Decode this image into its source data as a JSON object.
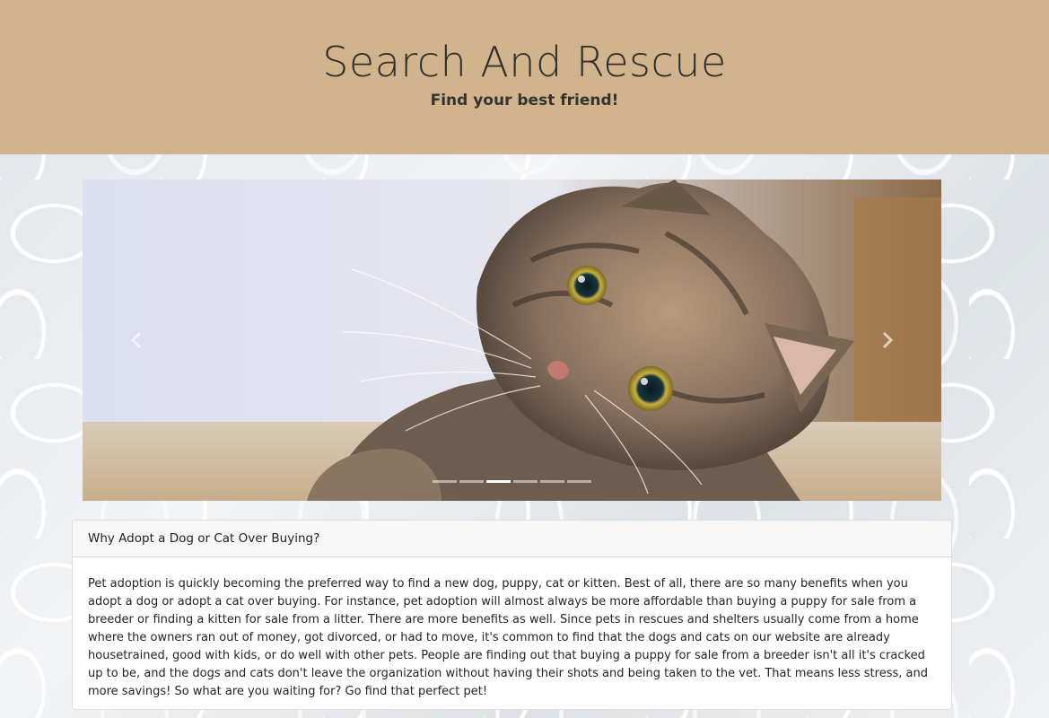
{
  "header": {
    "title": "Search And Rescue",
    "subtitle": "Find your best friend!"
  },
  "carousel": {
    "image_description_icon": "tabby-cat-photo",
    "prev_icon": "chevron-left-icon",
    "next_icon": "chevron-right-icon",
    "indicator_count": 6,
    "active_index": 2
  },
  "card": {
    "header": "Why Adopt a Dog or Cat Over Buying?",
    "body": "Pet adoption is quickly becoming the preferred way to find a new dog, puppy, cat or kitten. Best of all, there are so many benefits when you adopt a dog or adopt a cat over buying. For instance, pet adoption will almost always be more affordable than buying a puppy for sale from a breeder or finding a kitten for sale from a litter. There are more benefits as well. Since pets in rescues and shelters usually come from a home where the owners ran out of money, got divorced, or had to move, it's common to find that the dogs and cats on our website are already housetrained, good with kids, or do well with other pets. People are finding out that buying a puppy for sale from a breeder isn't all it's cracked up to be, and the dogs and cats don't leave the organization without having their shots and being taken to the vet. That means less stress, and more savings! So what are you waiting for? Go find that perfect pet!"
  },
  "colors": {
    "header_bg": "#d2b48c",
    "card_header_bg": "#f7f7f7"
  }
}
